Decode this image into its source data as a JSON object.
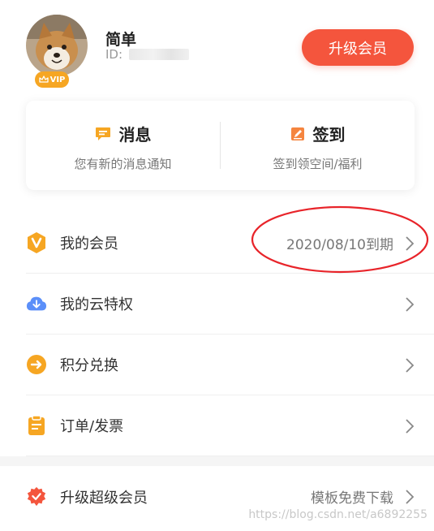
{
  "profile": {
    "username": "简单",
    "id_label": "ID:",
    "vip_label": "VIP",
    "upgrade_button": "升级会员"
  },
  "card": {
    "messages": {
      "title": "消息",
      "subtitle": "您有新的消息通知",
      "icon": "message-icon"
    },
    "checkin": {
      "title": "签到",
      "subtitle": "签到领空间/福利",
      "icon": "checkin-icon"
    }
  },
  "menu": {
    "items": [
      {
        "label": "我的会员",
        "value": "2020/08/10到期",
        "icon": "member-v-icon"
      },
      {
        "label": "我的云特权",
        "value": "",
        "icon": "cloud-download-icon"
      },
      {
        "label": "积分兑换",
        "value": "",
        "icon": "points-exchange-icon"
      },
      {
        "label": "订单/发票",
        "value": "",
        "icon": "order-clipboard-icon"
      }
    ],
    "super": {
      "label": "升级超级会员",
      "value": "模板免费下载",
      "icon": "super-member-badge-icon"
    }
  },
  "colors": {
    "accent": "#f4553d",
    "vip_badge": "#f6a623",
    "annotation": "#e8242a"
  },
  "watermark": "https://blog.csdn.net/a6892255"
}
